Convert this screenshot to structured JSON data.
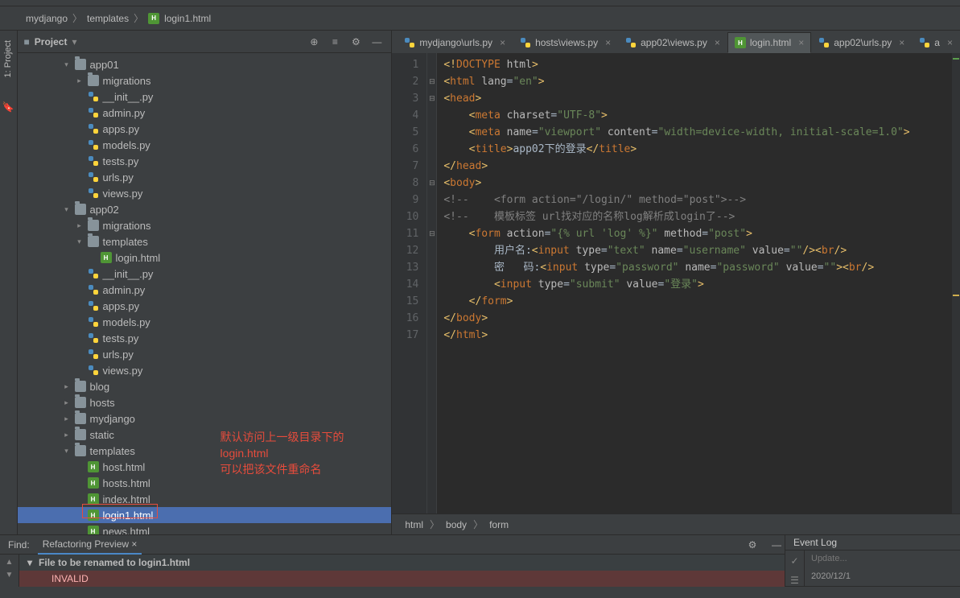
{
  "breadcrumb": {
    "a": "mydjango",
    "b": "templates",
    "c": "login1.html"
  },
  "panel": {
    "title": "Project"
  },
  "tree": [
    {
      "d": 2,
      "a": "v",
      "i": "dir",
      "n": "app01"
    },
    {
      "d": 3,
      "a": ">",
      "i": "dir",
      "n": "migrations"
    },
    {
      "d": 3,
      "a": "",
      "i": "py",
      "n": "__init__.py"
    },
    {
      "d": 3,
      "a": "",
      "i": "py",
      "n": "admin.py"
    },
    {
      "d": 3,
      "a": "",
      "i": "py",
      "n": "apps.py"
    },
    {
      "d": 3,
      "a": "",
      "i": "py",
      "n": "models.py"
    },
    {
      "d": 3,
      "a": "",
      "i": "py",
      "n": "tests.py"
    },
    {
      "d": 3,
      "a": "",
      "i": "py",
      "n": "urls.py"
    },
    {
      "d": 3,
      "a": "",
      "i": "py",
      "n": "views.py"
    },
    {
      "d": 2,
      "a": "v",
      "i": "dir",
      "n": "app02"
    },
    {
      "d": 3,
      "a": ">",
      "i": "dir",
      "n": "migrations"
    },
    {
      "d": 3,
      "a": "v",
      "i": "dir",
      "n": "templates"
    },
    {
      "d": 4,
      "a": "",
      "i": "html",
      "n": "login.html"
    },
    {
      "d": 3,
      "a": "",
      "i": "py",
      "n": "__init__.py"
    },
    {
      "d": 3,
      "a": "",
      "i": "py",
      "n": "admin.py"
    },
    {
      "d": 3,
      "a": "",
      "i": "py",
      "n": "apps.py"
    },
    {
      "d": 3,
      "a": "",
      "i": "py",
      "n": "models.py"
    },
    {
      "d": 3,
      "a": "",
      "i": "py",
      "n": "tests.py"
    },
    {
      "d": 3,
      "a": "",
      "i": "py",
      "n": "urls.py"
    },
    {
      "d": 3,
      "a": "",
      "i": "py",
      "n": "views.py"
    },
    {
      "d": 2,
      "a": ">",
      "i": "dir",
      "n": "blog"
    },
    {
      "d": 2,
      "a": ">",
      "i": "dir",
      "n": "hosts"
    },
    {
      "d": 2,
      "a": ">",
      "i": "dir",
      "n": "mydjango"
    },
    {
      "d": 2,
      "a": ">",
      "i": "dir",
      "n": "static"
    },
    {
      "d": 2,
      "a": "v",
      "i": "dir",
      "n": "templates"
    },
    {
      "d": 3,
      "a": "",
      "i": "html",
      "n": "host.html"
    },
    {
      "d": 3,
      "a": "",
      "i": "html",
      "n": "hosts.html"
    },
    {
      "d": 3,
      "a": "",
      "i": "html",
      "n": "index.html"
    },
    {
      "d": 3,
      "a": "",
      "i": "html",
      "n": "login1.html",
      "sel": true
    },
    {
      "d": 3,
      "a": "",
      "i": "html",
      "n": "news.html"
    }
  ],
  "tabs": [
    {
      "i": "py",
      "n": "mydjango\\urls.py"
    },
    {
      "i": "py",
      "n": "hosts\\views.py"
    },
    {
      "i": "py",
      "n": "app02\\views.py"
    },
    {
      "i": "html",
      "n": "login.html",
      "active": true
    },
    {
      "i": "py",
      "n": "app02\\urls.py"
    },
    {
      "i": "py",
      "n": "a"
    }
  ],
  "lines": 17,
  "crumb2": {
    "a": "html",
    "b": "body",
    "c": "form"
  },
  "find": {
    "label": "Find:",
    "tab": "Refactoring Preview",
    "head": "File to be renamed to login1.html",
    "err": "INVALID"
  },
  "eventlog": {
    "title": "Event Log",
    "upd": "Update...",
    "date": "2020/12/1"
  },
  "red": {
    "l1": "默认访问上一级目录下的login.html",
    "l2": "可以把该文件重命名"
  },
  "icons": {
    "proj": "■",
    "target": "⊕",
    "collapse": "≡",
    "gear": "⚙",
    "hide": "—",
    "arrowD": "▾",
    "arrowR": "▸",
    "close": "×",
    "chk": "✓",
    "up": "▲",
    "dn": "▼"
  }
}
